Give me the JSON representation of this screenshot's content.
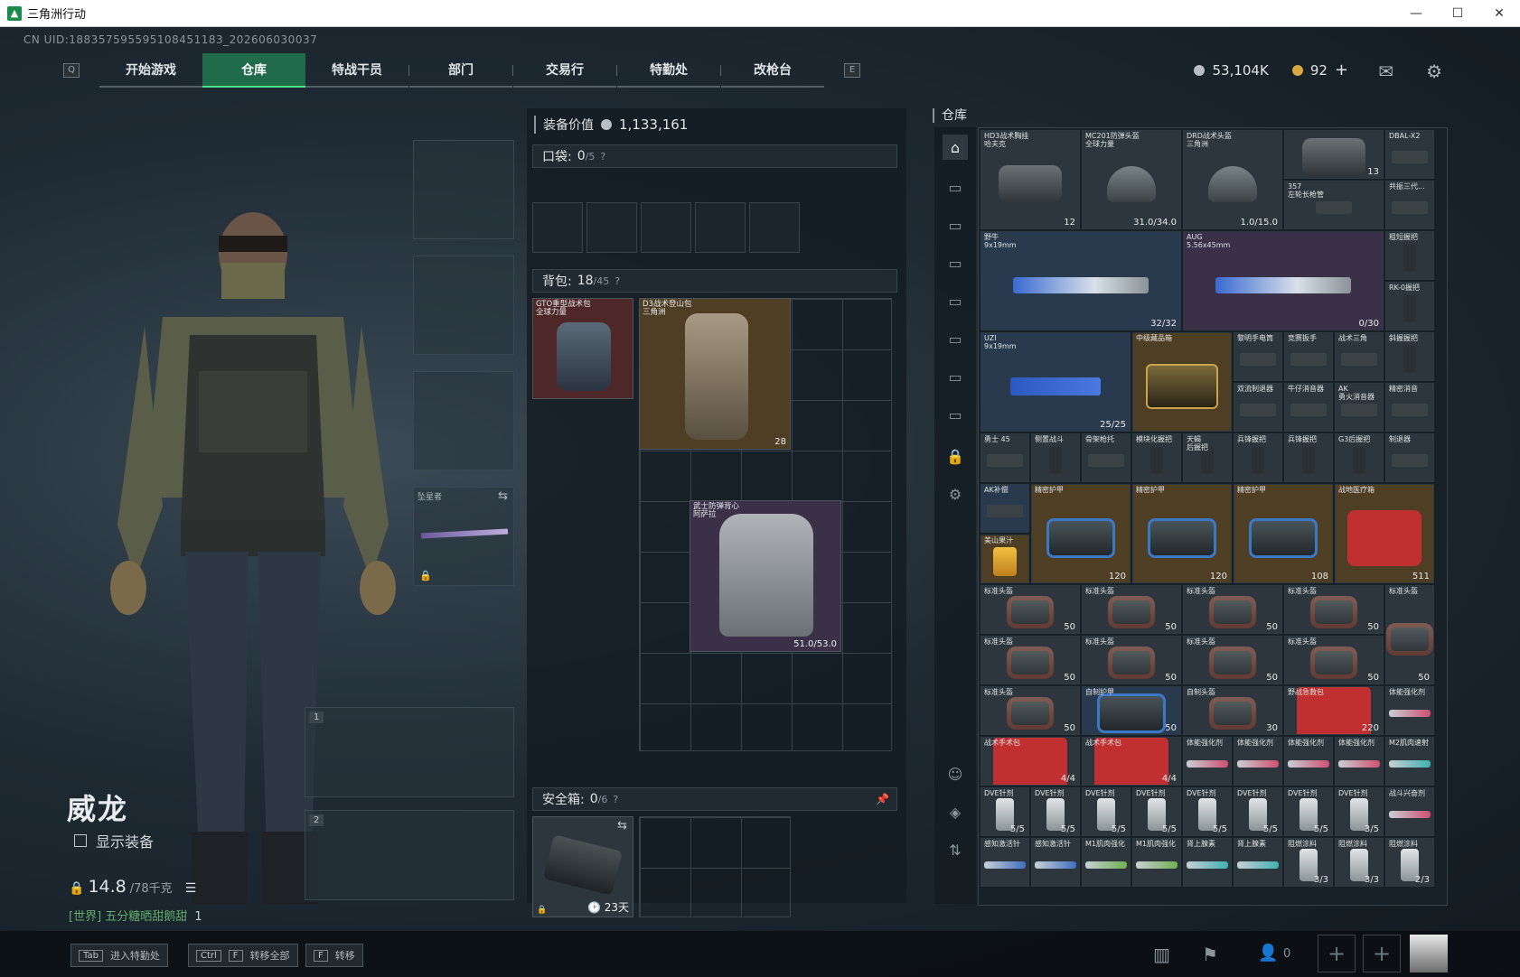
{
  "window": {
    "title": "三角洲行动",
    "minimize": "—",
    "maximize": "☐",
    "close": "✕"
  },
  "uid": "CN UID:188357595595108451183_202606030037",
  "nav": {
    "left_key": "Q",
    "right_key": "E",
    "tabs": [
      "开始游戏",
      "仓库",
      "特战干员",
      "部门",
      "交易行",
      "特勤处",
      "改枪台"
    ],
    "active_tab": "仓库"
  },
  "currency": {
    "silver": "53,104K",
    "gold": "92",
    "add": "+"
  },
  "character": {
    "name": "威龙",
    "show_gear_label": "显示装备",
    "weight_value": "14.8",
    "weight_max": "/78千克",
    "world_chat": "[世界] 五分糖晒甜鹅甜",
    "world_chat_count": "1"
  },
  "equipment": {
    "melee_label": "坠星者",
    "slot1_num": "1",
    "slot2_num": "2"
  },
  "loadout": {
    "value_label": "装备价值",
    "value": "1,133,161",
    "pocket_label": "口袋:",
    "pocket_count": "0",
    "pocket_max": "/5",
    "backpack_label": "背包:",
    "backpack_count": "18",
    "backpack_max": "/45",
    "safebox_label": "安全箱:",
    "safebox_count": "0",
    "safebox_max": "/6",
    "safebox_timer": "23天",
    "help": "?"
  },
  "backpack_items": [
    {
      "name": "GTO重型战术包\n全球力量",
      "badge": ""
    },
    {
      "name": "D3战术登山包\n三角洲",
      "badge": "28"
    },
    {
      "name": "武士防弹背心\n阿萨拉",
      "badge": "51.0/53.0"
    }
  ],
  "warehouse": {
    "title": "仓库",
    "items": [
      {
        "name": "HD3战术胸挂\n哈夫克",
        "badge": "12"
      },
      {
        "name": "MC201防弹头盔\n全球力量",
        "badge": "31.0/34.0"
      },
      {
        "name": "DRD战术头盔\n三角洲",
        "badge": "1.0/15.0"
      },
      {
        "name": "",
        "badge": "13"
      },
      {
        "name": "DBAL-X2",
        "badge": ""
      },
      {
        "name": "357\n左轮长枪管",
        "badge": ""
      },
      {
        "name": "共振三代...",
        "badge": ""
      },
      {
        "name": "野牛\n9x19mm",
        "badge": "32/32"
      },
      {
        "name": "AUG\n5.56x45mm",
        "badge": "0/30"
      },
      {
        "name": "粗短握把",
        "badge": ""
      },
      {
        "name": "RK-0握把",
        "badge": ""
      },
      {
        "name": "UZI\n9x19mm",
        "badge": "25/25"
      },
      {
        "name": "中级藏品箱",
        "badge": ""
      },
      {
        "name": "黎明手电筒",
        "badge": ""
      },
      {
        "name": "竞赛扳手",
        "badge": ""
      },
      {
        "name": "战术三角",
        "badge": ""
      },
      {
        "name": "斜握握把",
        "badge": ""
      },
      {
        "name": "双流制退器",
        "badge": ""
      },
      {
        "name": "牛仔消音器",
        "badge": ""
      },
      {
        "name": "AK\n勇火消音器",
        "badge": ""
      },
      {
        "name": "精密消音",
        "badge": ""
      },
      {
        "name": "勇士 45",
        "badge": ""
      },
      {
        "name": "侧置战斗",
        "badge": ""
      },
      {
        "name": "骨架枪托",
        "badge": ""
      },
      {
        "name": "模块化握把",
        "badge": ""
      },
      {
        "name": "天蝎\n后握把",
        "badge": ""
      },
      {
        "name": "兵锋握把",
        "badge": ""
      },
      {
        "name": "兵锋握把",
        "badge": ""
      },
      {
        "name": "G3后握把",
        "badge": ""
      },
      {
        "name": "制退器",
        "badge": ""
      },
      {
        "name": "AK补偿",
        "badge": ""
      },
      {
        "name": "美山果汁",
        "badge": ""
      },
      {
        "name": "精密护甲",
        "badge": "120"
      },
      {
        "name": "精密护甲",
        "badge": "120"
      },
      {
        "name": "精密护甲",
        "badge": "108"
      },
      {
        "name": "战地医疗箱",
        "badge": "511"
      },
      {
        "name": "标准头盔",
        "badge": "50"
      },
      {
        "name": "标准头盔",
        "badge": "50"
      },
      {
        "name": "标准头盔",
        "badge": "50"
      },
      {
        "name": "标准头盔",
        "badge": "50"
      },
      {
        "name": "标准头盔",
        "badge": "50"
      },
      {
        "name": "标准头盔",
        "badge": "50"
      },
      {
        "name": "标准头盔",
        "badge": "50"
      },
      {
        "name": "标准头盔",
        "badge": "50"
      },
      {
        "name": "标准头盔",
        "badge": "50"
      },
      {
        "name": "标准头盔",
        "badge": "50"
      },
      {
        "name": "标准头盔",
        "badge": "50"
      },
      {
        "name": "自制护甲",
        "badge": "50"
      },
      {
        "name": "自制头盔",
        "badge": "30"
      },
      {
        "name": "野战急救包",
        "badge": "220"
      },
      {
        "name": "体能强化剂",
        "badge": ""
      },
      {
        "name": "战术手术包",
        "badge": "4/4"
      },
      {
        "name": "战术手术包",
        "badge": "4/4"
      },
      {
        "name": "体能强化剂",
        "badge": ""
      },
      {
        "name": "体能强化剂",
        "badge": ""
      },
      {
        "name": "体能强化剂",
        "badge": ""
      },
      {
        "name": "体能强化剂",
        "badge": ""
      },
      {
        "name": "M2肌肉速射",
        "badge": ""
      },
      {
        "name": "DVE针剂",
        "badge": "5/5"
      },
      {
        "name": "DVE针剂",
        "badge": "5/5"
      },
      {
        "name": "DVE针剂",
        "badge": "5/5"
      },
      {
        "name": "DVE针剂",
        "badge": "5/5"
      },
      {
        "name": "DVE针剂",
        "badge": "5/5"
      },
      {
        "name": "DVE针剂",
        "badge": "5/5"
      },
      {
        "name": "DVE针剂",
        "badge": "5/5"
      },
      {
        "name": "DVE针剂",
        "badge": "3/5"
      },
      {
        "name": "战斗兴奋剂",
        "badge": ""
      },
      {
        "name": "感知激活针",
        "badge": ""
      },
      {
        "name": "感知激活针",
        "badge": ""
      },
      {
        "name": "M1肌肉强化",
        "badge": ""
      },
      {
        "name": "M1肌肉强化",
        "badge": ""
      },
      {
        "name": "肾上腺素",
        "badge": ""
      },
      {
        "name": "肾上腺素",
        "badge": ""
      },
      {
        "name": "阻燃涂料",
        "badge": "3/3"
      },
      {
        "name": "阻燃涂料",
        "badge": "3/3"
      },
      {
        "name": "阻燃涂料",
        "badge": "2/3"
      }
    ]
  },
  "bottom": {
    "tab_key": "Tab",
    "tab_label": "进入特勤处",
    "ctrl_key": "Ctrl",
    "f_key": "F",
    "transfer_all": "转移全部",
    "transfer_key": "F",
    "transfer": "转移",
    "friends": "0",
    "plus": "+"
  },
  "colors": {
    "accent_green": "#4be08a",
    "active_tab_bg": "#1f6b4a",
    "silver_coin": "#b8c0c4",
    "gold_coin": "#d8a840"
  },
  "icons": [
    "mail-icon",
    "gear-icon",
    "lock-icon",
    "swap-icon",
    "clock-icon",
    "pin-icon",
    "chart-icon",
    "flag-icon",
    "user-icon",
    "avatar"
  ]
}
